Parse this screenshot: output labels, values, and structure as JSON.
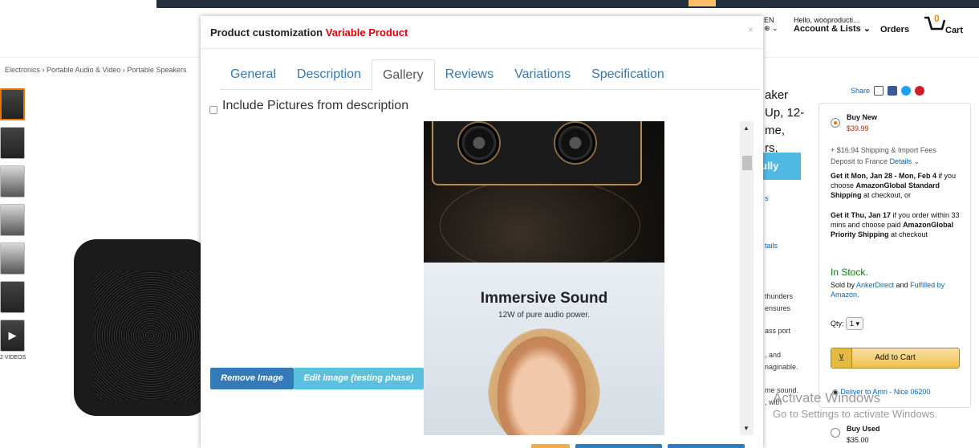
{
  "header": {
    "language": "EN",
    "globe": "⊕ ⌄",
    "greeting": "Hello, wooproducti...",
    "account_lists": "Account & Lists ⌄",
    "orders": "Orders",
    "cart_count": "0",
    "cart_label": "Cart"
  },
  "breadcrumb": "Electronics › Portable Audio & Video › Portable Speakers",
  "thumbnails_videos_label": "2 VIDEOS",
  "product_title_fragment": [
    "aker",
    "Up, 12-",
    "me,",
    "rs,"
  ],
  "fully_button": "ully",
  "side_texts": {
    "s1": "s",
    "s2": "tails",
    "s3": "thunders",
    "s4": "ensures",
    "s5": "ass port",
    "s6": ", and",
    "s7": "naginable.",
    "s8": "me sound.",
    "s9": ", with"
  },
  "buybox": {
    "share": "Share",
    "buy_new": "Buy New",
    "price_new": "$39.99",
    "shipping": "+ $16.94 Shipping & Import Fees",
    "deposit": "Deposit to France",
    "details": "Details ⌄",
    "get_it_1_bold": "Get it Mon, Jan 28 - Mon, Feb 4",
    "get_it_1_rest": " if you choose ",
    "get_it_1_bold2": "AmazonGlobal Standard Shipping",
    "get_it_1_end": " at checkout, or",
    "get_it_2_bold": "Get it Thu, Jan 17",
    "get_it_2_rest": " if you order within 33 mins and choose paid ",
    "get_it_2_bold2": "AmazonGlobal Priority Shipping",
    "get_it_2_end": " at checkout",
    "in_stock": "In Stock.",
    "sold_by_prefix": "Sold by ",
    "seller": "AnkerDirect",
    "and": " and ",
    "fulfilled": "Fulfilled by Amazon",
    "period": ".",
    "qty_label": "Qty:",
    "qty_value": "1",
    "add_to_cart": "Add to Cart",
    "deliver_to": "Deliver to Amri - Nice 06200",
    "buy_used": "Buy Used",
    "price_used": "$35.00"
  },
  "watermark": {
    "line1": "Activate Windows",
    "line2": "Go to Settings to activate Windows."
  },
  "modal": {
    "title_prefix": "Product customization ",
    "title_type": "Variable Product",
    "close": "×",
    "tabs": [
      "General",
      "Description",
      "Gallery",
      "Reviews",
      "Variations",
      "Specification"
    ],
    "active_tab": "Gallery",
    "include_label": "Include Pictures from description",
    "remove_image": "Remove Image",
    "edit_image": "Edit image (testing phase)",
    "image2_heading": "Immersive Sound",
    "image2_sub": "12W of pure audio power."
  },
  "colors": {
    "accent_blue": "#337ab7",
    "info_blue": "#5bc0de",
    "red": "#e60000",
    "amazon_orange": "#e77600"
  }
}
